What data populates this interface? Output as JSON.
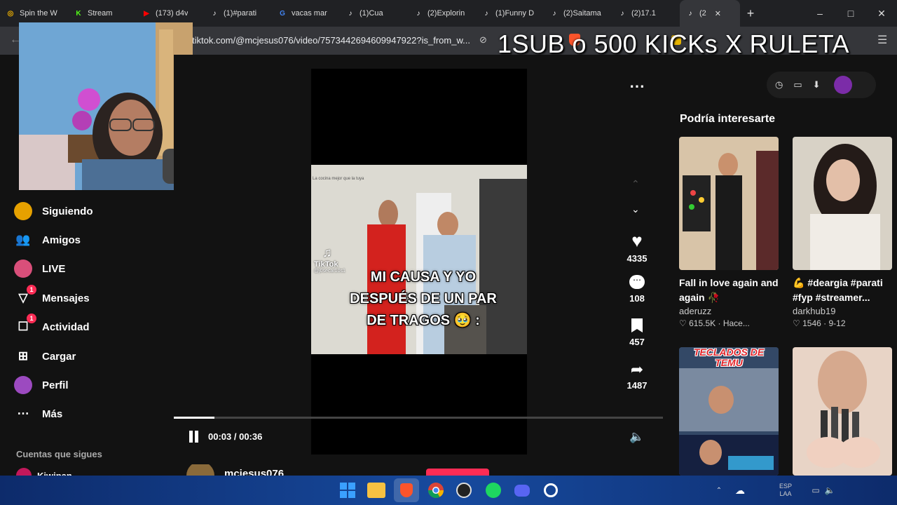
{
  "tabs": [
    {
      "label": "Spin the W",
      "icon": "wheel-icon",
      "color": "#f4b400"
    },
    {
      "label": "Stream",
      "icon": "kick-icon",
      "color": "#53fc18"
    },
    {
      "label": "(173) d4v",
      "icon": "youtube-icon",
      "color": "#ff0000"
    },
    {
      "label": "(1)#parati",
      "icon": "tiktok-icon",
      "color": "#ffffff"
    },
    {
      "label": "vacas mar",
      "icon": "google-icon",
      "color": "#4285f4"
    },
    {
      "label": "(1)Cua",
      "icon": "tiktok-icon",
      "color": "#ffffff"
    },
    {
      "label": "(2)Explorin",
      "icon": "tiktok-icon",
      "color": "#ffffff"
    },
    {
      "label": "(1)Funny D",
      "icon": "tiktok-icon",
      "color": "#ffffff"
    },
    {
      "label": "(2)Saitama",
      "icon": "tiktok-icon",
      "color": "#ffffff"
    },
    {
      "label": "(2)17.1",
      "icon": "tiktok-icon",
      "color": "#ffffff"
    },
    {
      "label": "(2",
      "icon": "tiktok-icon",
      "color": "#ffffff",
      "active": true
    }
  ],
  "address": {
    "url": "tiktok.com/@mcjesus076/video/7573442694609947922?is_from_w..."
  },
  "stream_overlay": "1SUB o 500 KICKs X RULETA",
  "nav": {
    "items": [
      {
        "label": "Siguiendo",
        "icon": "following-avatar-icon"
      },
      {
        "label": "Amigos",
        "icon": "friends-icon"
      },
      {
        "label": "LIVE",
        "icon": "live-avatar-icon"
      },
      {
        "label": "Mensajes",
        "icon": "messages-icon",
        "badge": "1"
      },
      {
        "label": "Actividad",
        "icon": "activity-icon",
        "badge": "1"
      },
      {
        "label": "Cargar",
        "icon": "upload-icon"
      },
      {
        "label": "Perfil",
        "icon": "profile-avatar-icon"
      },
      {
        "label": "Más",
        "icon": "more-dots-icon"
      }
    ],
    "following_heading": "Cuentas que sigues",
    "following_first": "Kiwipan"
  },
  "video": {
    "caption_line1": "MI CAUSA Y YO",
    "caption_line2": "DESPUÉS DE UN PAR",
    "caption_line3": "DE TRAGOS 🥹 :",
    "watermark_brand": "TikTok",
    "watermark_handle": "@j0secar10s1",
    "top_text": "La cocina mejor que la tuya",
    "time_current": "00:03",
    "time_total": "00:36",
    "time_separator": " / ",
    "progress": 0.0833,
    "author": "mcjesus076"
  },
  "actions": {
    "likes": "4335",
    "comments": "108",
    "saves": "457",
    "shares": "1487"
  },
  "sidebar": {
    "heading": "Podría interesarte",
    "cards": [
      {
        "title": "Fall in love again and again 🥀",
        "author": "aderuzz",
        "likes": "615.5K",
        "date": "Hace..."
      },
      {
        "title": "💪 #deargia #parati #fyp #streamer...",
        "author": "darkhub19",
        "likes": "1546",
        "date": "9-12"
      },
      {
        "title": "",
        "banner": "TECLADOS DE TEMU",
        "author": "",
        "likes": "",
        "date": ""
      },
      {
        "title": "",
        "author": "",
        "likes": "",
        "date": ""
      }
    ]
  },
  "taskbar": {
    "lang_top": "ESP",
    "lang_bottom": "LAA"
  },
  "colors": {
    "tiktok_red": "#fe2c55",
    "bg": "#121212",
    "taskbar": "#174a9e"
  }
}
